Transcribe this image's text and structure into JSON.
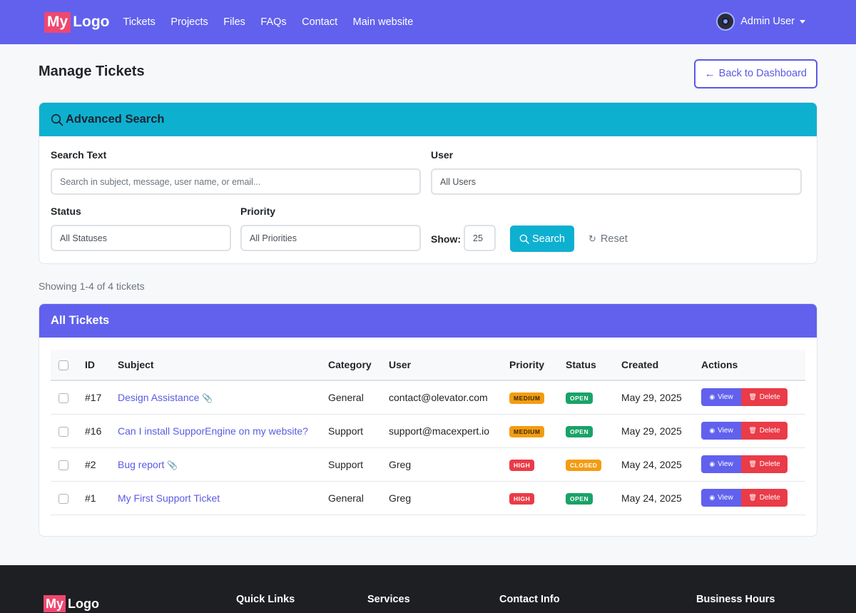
{
  "nav": {
    "logo_my": "My",
    "logo_text": "Logo",
    "links": [
      "Tickets",
      "Projects",
      "Files",
      "FAQs",
      "Contact",
      "Main website"
    ],
    "user_name": "Admin User"
  },
  "page": {
    "title": "Manage Tickets",
    "back_label": "Back to Dashboard"
  },
  "search": {
    "header": "Advanced Search",
    "search_text_label": "Search Text",
    "search_text_placeholder": "Search in subject, message, user name, or email...",
    "user_label": "User",
    "user_value": "All Users",
    "status_label": "Status",
    "status_value": "All Statuses",
    "priority_label": "Priority",
    "priority_value": "All Priorities",
    "show_label": "Show:",
    "show_value": "25",
    "search_button": "Search",
    "reset_button": "Reset"
  },
  "summary": "Showing 1-4 of 4 tickets",
  "tickets": {
    "header": "All Tickets",
    "columns": [
      "ID",
      "Subject",
      "Category",
      "User",
      "Priority",
      "Status",
      "Created",
      "Actions"
    ],
    "view_label": "View",
    "delete_label": "Delete",
    "rows": [
      {
        "id": "#17",
        "subject": "Design Assistance",
        "attachment": true,
        "category": "General",
        "user": "contact@olevator.com",
        "priority": "MEDIUM",
        "status": "OPEN",
        "created": "May 29, 2025"
      },
      {
        "id": "#16",
        "subject": "Can I install SupporEngine on my website?",
        "attachment": false,
        "category": "Support",
        "user": "support@macexpert.io",
        "priority": "MEDIUM",
        "status": "OPEN",
        "created": "May 29, 2025"
      },
      {
        "id": "#2",
        "subject": "Bug report",
        "attachment": true,
        "category": "Support",
        "user": "Greg",
        "priority": "HIGH",
        "status": "CLOSED",
        "created": "May 24, 2025"
      },
      {
        "id": "#1",
        "subject": "My First Support Ticket",
        "attachment": false,
        "category": "General",
        "user": "Greg",
        "priority": "HIGH",
        "status": "OPEN",
        "created": "May 24, 2025"
      }
    ]
  },
  "footer": {
    "logo_my": "My",
    "logo_text": "Logo",
    "columns": [
      "Quick Links",
      "Services",
      "Contact Info",
      "Business Hours"
    ]
  },
  "colors": {
    "primary": "#6161ee",
    "info": "#0eb0d0",
    "danger": "#ea3b48",
    "warning": "#f39c12",
    "success": "#19a368",
    "footer_bg": "#1e1f23"
  }
}
